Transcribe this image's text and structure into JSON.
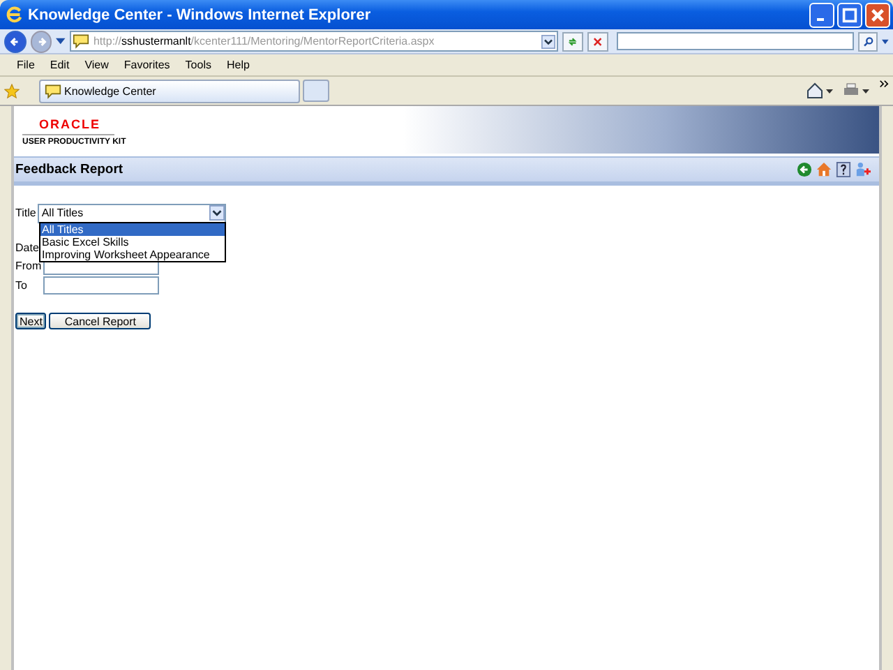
{
  "window": {
    "title": "Knowledge Center - Windows Internet Explorer"
  },
  "address_bar": {
    "value_prefix": "http://",
    "value_host": "sshustermanlt",
    "value_path": "/kcenter111/Mentoring/MentorReportCriteria.aspx"
  },
  "menu": [
    "File",
    "Edit",
    "View",
    "Favorites",
    "Tools",
    "Help"
  ],
  "tabs": [
    {
      "label": "Knowledge Center",
      "selected": true
    }
  ],
  "header": {
    "logo": "ORACLE",
    "subtitle": "USER PRODUCTIVITY KIT"
  },
  "report": {
    "title": "Feedback Report",
    "title_field": {
      "label": "Title",
      "value": "All Titles",
      "options": [
        {
          "label": "All Titles",
          "selected": true
        },
        {
          "label": "Basic Excel Skills",
          "selected": false
        },
        {
          "label": "Improving Worksheet Appearance",
          "selected": false
        }
      ]
    },
    "date_label": "Date",
    "from_label": "From",
    "to_label": "To",
    "buttons": [
      "Next",
      "Cancel Report"
    ]
  }
}
